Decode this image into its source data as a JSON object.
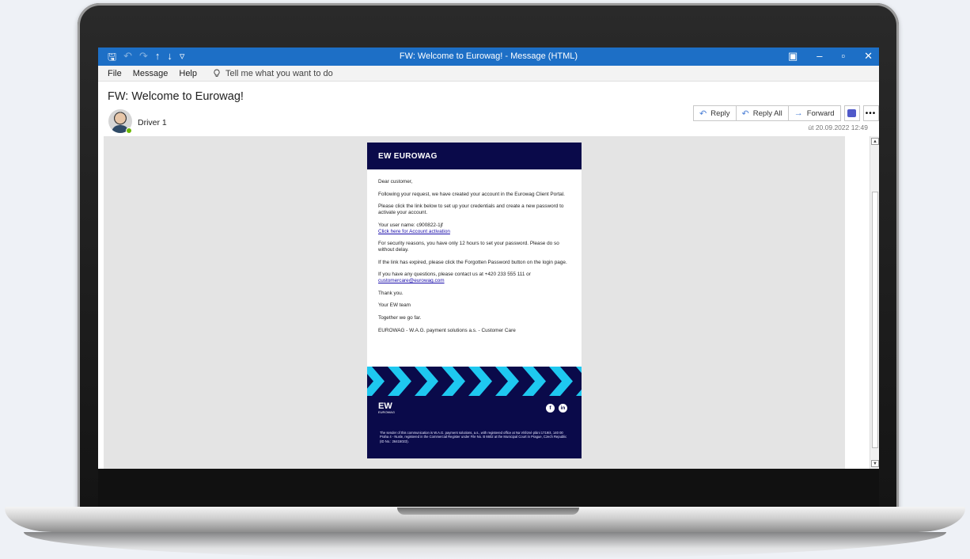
{
  "window": {
    "title": "FW: Welcome to Eurowag! - Message (HTML)",
    "controls": {
      "display": "▣",
      "minimize": "–",
      "restore": "▫",
      "close": "✕"
    },
    "quick_access": {
      "save": "🖫",
      "undo": "↶",
      "redo": "↷",
      "up": "↑",
      "down": "↓",
      "customize": "▿"
    }
  },
  "menu": {
    "items": [
      "File",
      "Message",
      "Help"
    ],
    "tell_me": "Tell me what you want to do"
  },
  "message": {
    "subject": "FW: Welcome to Eurowag!",
    "sender": "Driver 1",
    "date": "út 20.09.2022 12:49",
    "actions": {
      "reply": "Reply",
      "reply_all": "Reply All",
      "forward": "Forward",
      "more": "•••"
    }
  },
  "email": {
    "brand": "EW EUROWAG",
    "greeting": "Dear customer,",
    "p1": "Following your request, we have created your account in the Eurowag Client Portal.",
    "p2": "Please click the link below to set up your credentials and create a new password to activate your account.",
    "username_line": "Your user name: c900822-1jf",
    "activation_link": "Click here for Account activation",
    "p3": "For security reasons, you have only 12 hours to set your password. Please do so without delay.",
    "p4": "If the link has expired, please click the Forgotten Password button on the login page.",
    "p5": "If you have any questions, please contact us at +420 233 555 111 or",
    "contact_email": "customercare@eurowag.com",
    "thanks": "Thank you.",
    "team": "Your EW team",
    "slogan": "Together we go far.",
    "company": "EUROWAG - W.A.G. payment solutions a.s. - Customer Care",
    "footer_logo": "EW",
    "footer_logo_sub": "EUROWAG",
    "social": {
      "facebook": "f",
      "linkedin": "in"
    },
    "legal": "The sender of this communication is W.A.G. payment solutions, a.s., with registered office at Na Vítězné pláni 1719/4, 140 00 Praha 4 - Nusle, registered in the Commercial Register under File No. B 6602 at the Municipal Court in Prague, Czech Republic (ID No.: 26415023)."
  },
  "colors": {
    "titlebar": "#1d6fc6",
    "brand_navy": "#0a0a4a",
    "chevron": "#1ec8f0"
  }
}
